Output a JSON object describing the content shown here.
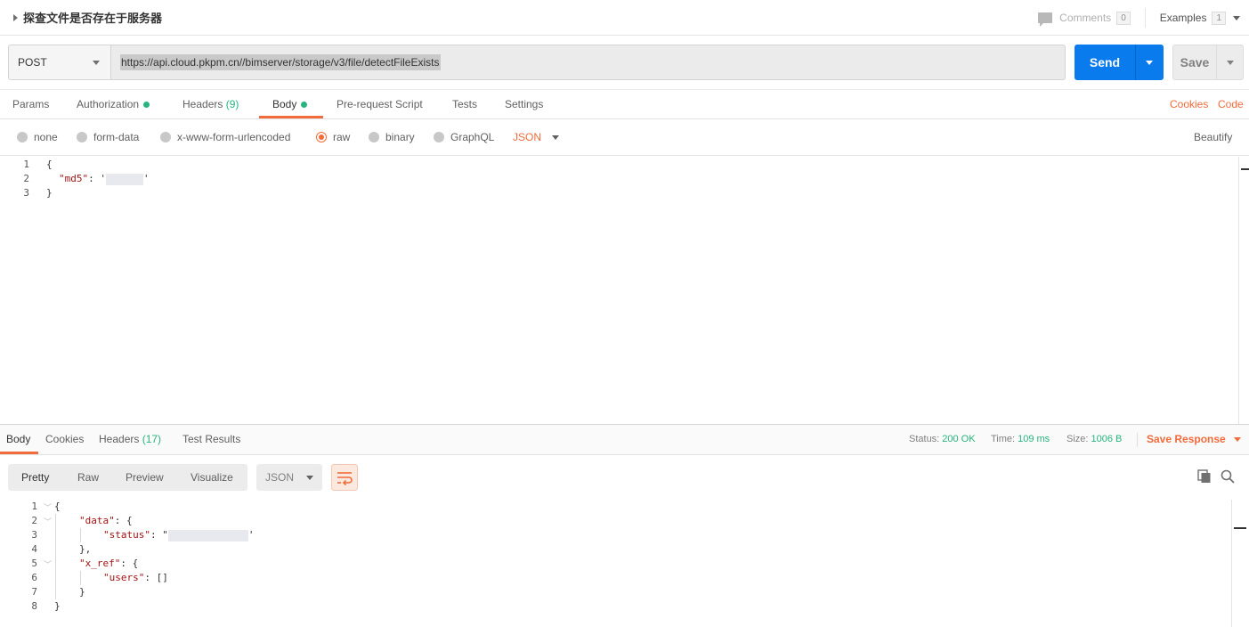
{
  "request": {
    "name": "探查文件是否存在于服务器",
    "comments_label": "Comments",
    "comments_count": "0",
    "examples_label": "Examples",
    "examples_count": "1",
    "method": "POST",
    "url": "https://api.cloud.pkpm.cn//bimserver/storage/v3/file/detectFileExists",
    "send_label": "Send",
    "save_label": "Save"
  },
  "request_tabs": {
    "params": "Params",
    "authorization": "Authorization",
    "headers": "Headers",
    "headers_count": "(9)",
    "body": "Body",
    "prerequest": "Pre-request Script",
    "tests": "Tests",
    "settings": "Settings",
    "cookies": "Cookies",
    "code": "Code"
  },
  "body_options": {
    "none": "none",
    "form_data": "form-data",
    "urlencoded": "x-www-form-urlencoded",
    "raw": "raw",
    "binary": "binary",
    "graphql": "GraphQL",
    "selected_type": "JSON",
    "beautify": "Beautify"
  },
  "request_body": {
    "line_numbers": [
      "1",
      "2",
      "3"
    ],
    "line1": "{",
    "key_md5": "\"md5\"",
    "line3": "}"
  },
  "response_tabs": {
    "body": "Body",
    "cookies": "Cookies",
    "headers": "Headers",
    "headers_count": "(17)",
    "test_results": "Test Results",
    "status_label": "Status:",
    "status_value": "200 OK",
    "time_label": "Time:",
    "time_value": "109 ms",
    "size_label": "Size:",
    "size_value": "1006 B",
    "save_response": "Save Response"
  },
  "response_view": {
    "pretty": "Pretty",
    "raw": "Raw",
    "preview": "Preview",
    "visualize": "Visualize",
    "format": "JSON"
  },
  "response_body": {
    "line_numbers": [
      "1",
      "2",
      "3",
      "4",
      "5",
      "6",
      "7",
      "8"
    ],
    "l1": "{",
    "key_data": "\"data\"",
    "key_status": "\"status\"",
    "l4": "},",
    "key_xref": "\"x_ref\"",
    "key_users": "\"users\"",
    "users_value": "[]",
    "l7": "}",
    "l8": "}"
  },
  "colors": {
    "accent": "#f26b3a",
    "send": "#097bed",
    "success": "#26b47f"
  }
}
